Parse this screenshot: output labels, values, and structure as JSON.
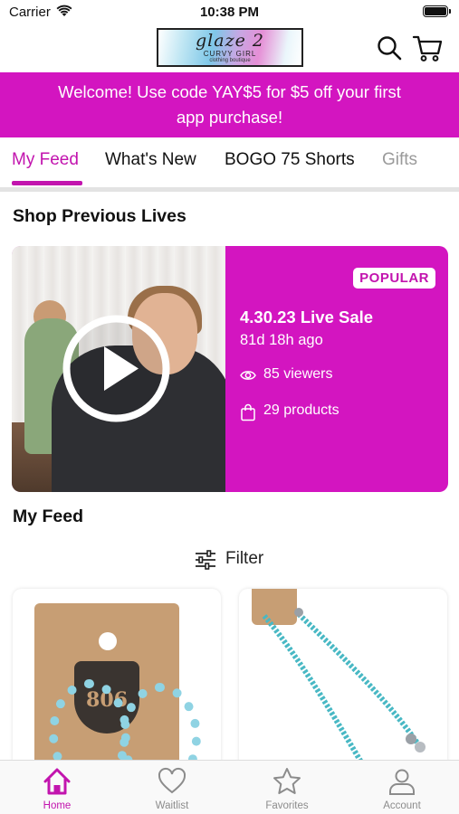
{
  "status_bar": {
    "carrier": "Carrier",
    "time": "10:38 PM"
  },
  "header": {
    "logo": {
      "title": "glaze 2",
      "subtitle": "CURVY GIRL",
      "tagline": "clothing boutique"
    },
    "icons": [
      "search-icon",
      "cart-icon"
    ]
  },
  "promo": {
    "line1": "Welcome! Use code YAY$5 for $5 off your first",
    "line2": "app purchase!"
  },
  "tabs": [
    {
      "label": "My Feed",
      "active": true
    },
    {
      "label": "What's New"
    },
    {
      "label": "BOGO 75 Shorts"
    },
    {
      "label": "Gifts"
    }
  ],
  "shop_previous_lives": {
    "title": "Shop Previous Lives",
    "card": {
      "badge": "POPULAR",
      "title": "4.30.23 Live Sale",
      "time_ago": "81d 18h ago",
      "viewers": "85 viewers",
      "products": "29 products"
    }
  },
  "my_feed": {
    "title": "My Feed",
    "filter_label": "Filter"
  },
  "colors": {
    "accent": "#d315c0",
    "accent_text": "#c214ae"
  },
  "bottom_tabs": [
    {
      "label": "Home",
      "icon": "home-icon",
      "active": true
    },
    {
      "label": "Waitlist",
      "icon": "heart-icon"
    },
    {
      "label": "Favorites",
      "icon": "star-icon"
    },
    {
      "label": "Account",
      "icon": "account-icon"
    }
  ]
}
